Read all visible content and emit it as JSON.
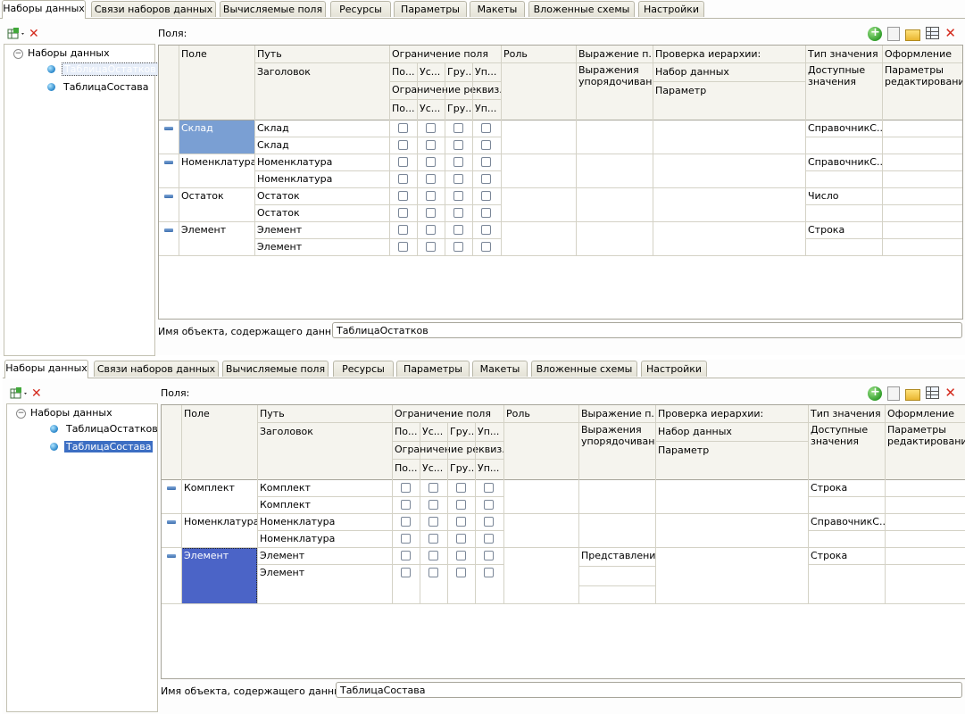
{
  "tabs": [
    "Наборы данных",
    "Связи наборов данных",
    "Вычисляемые поля",
    "Ресурсы",
    "Параметры",
    "Макеты",
    "Вложенные схемы",
    "Настройки"
  ],
  "tree": {
    "root": "Наборы данных",
    "items": [
      "ТаблицаОстатков",
      "ТаблицаСостава"
    ]
  },
  "fields_label": "Поля:",
  "columns": {
    "field": "Поле",
    "path": "Путь",
    "title": "Заголовок",
    "restrict": "Ограничение поля",
    "restrict_subs": [
      "По...",
      "Ус...",
      "Гру...",
      "Уп..."
    ],
    "restrict_req": "Ограничение реквиз...",
    "role": "Роль",
    "expr": "Выражение п...",
    "expr_order": "Выражения упорядочивани",
    "hier": "Проверка иерархии:",
    "hier_set": "Набор данных",
    "hier_param": "Параметр",
    "type": "Тип значения",
    "avail": "Доступные значения",
    "format": "Оформление",
    "edit_params": "Параметры редактировани"
  },
  "panel1": {
    "rows": [
      {
        "field": "Склад",
        "path": "Склад",
        "title": "Склад",
        "type": "СправочникС..."
      },
      {
        "field": "Номенклатура",
        "path": "Номенклатура",
        "title": "Номенклатура",
        "type": "СправочникС..."
      },
      {
        "field": "Остаток",
        "path": "Остаток",
        "title": "Остаток",
        "type": "Число"
      },
      {
        "field": "Элемент",
        "path": "Элемент",
        "title": "Элемент",
        "type": "Строка"
      }
    ],
    "obj_label": "Имя объекта, содержащего данные:",
    "obj_value": "ТаблицаОстатков"
  },
  "panel2": {
    "rows": [
      {
        "field": "Комплект",
        "path": "Комплект",
        "title": "Комплект",
        "type": "Строка"
      },
      {
        "field": "Номенклатура",
        "path": "Номенклатура",
        "title": "Номенклатура",
        "type": "СправочникС..."
      },
      {
        "field": "Элемент",
        "path": "Элемент",
        "title": "Элемент",
        "type": "Строка",
        "expr": "Представлени"
      }
    ],
    "obj_label": "Имя объекта, содержащего данные:",
    "obj_value": "ТаблицаСостава"
  }
}
